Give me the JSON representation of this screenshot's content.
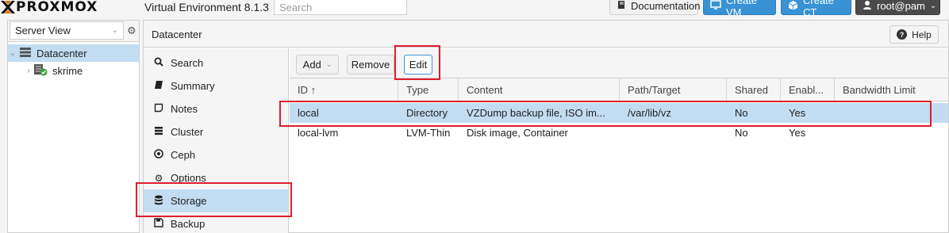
{
  "header": {
    "logo_text": "PROXMOX",
    "version": "Virtual Environment 8.1.3",
    "search_placeholder": "Search",
    "documentation": "Documentation",
    "create_vm": "Create VM",
    "create_ct": "Create CT",
    "user": "root@pam"
  },
  "left": {
    "view": "Server View",
    "tree": [
      {
        "label": "Datacenter"
      },
      {
        "label": "skrime"
      }
    ]
  },
  "main": {
    "title": "Datacenter",
    "help": "Help"
  },
  "nav": [
    {
      "label": "Search",
      "icon": "search-icon"
    },
    {
      "label": "Summary",
      "icon": "book-icon"
    },
    {
      "label": "Notes",
      "icon": "note-icon"
    },
    {
      "label": "Cluster",
      "icon": "server-icon"
    },
    {
      "label": "Ceph",
      "icon": "ceph-icon"
    },
    {
      "label": "Options",
      "icon": "gear-icon"
    },
    {
      "label": "Storage",
      "icon": "database-icon"
    },
    {
      "label": "Backup",
      "icon": "floppy-icon"
    }
  ],
  "toolbar": {
    "add": "Add",
    "remove": "Remove",
    "edit": "Edit"
  },
  "table": {
    "columns": [
      "ID ↑",
      "Type",
      "Content",
      "Path/Target",
      "Shared",
      "Enabl...",
      "Bandwidth Limit"
    ],
    "rows": [
      [
        "local",
        "Directory",
        "VZDump backup file, ISO im...",
        "/var/lib/vz",
        "No",
        "Yes",
        ""
      ],
      [
        "local-lvm",
        "LVM-Thin",
        "Disk image, Container",
        "",
        "No",
        "Yes",
        ""
      ]
    ]
  },
  "colors": {
    "selection": "#c2dcf2",
    "accent": "#3892d4",
    "highlight": "#e01e2b",
    "logo_x": "#e57000"
  }
}
